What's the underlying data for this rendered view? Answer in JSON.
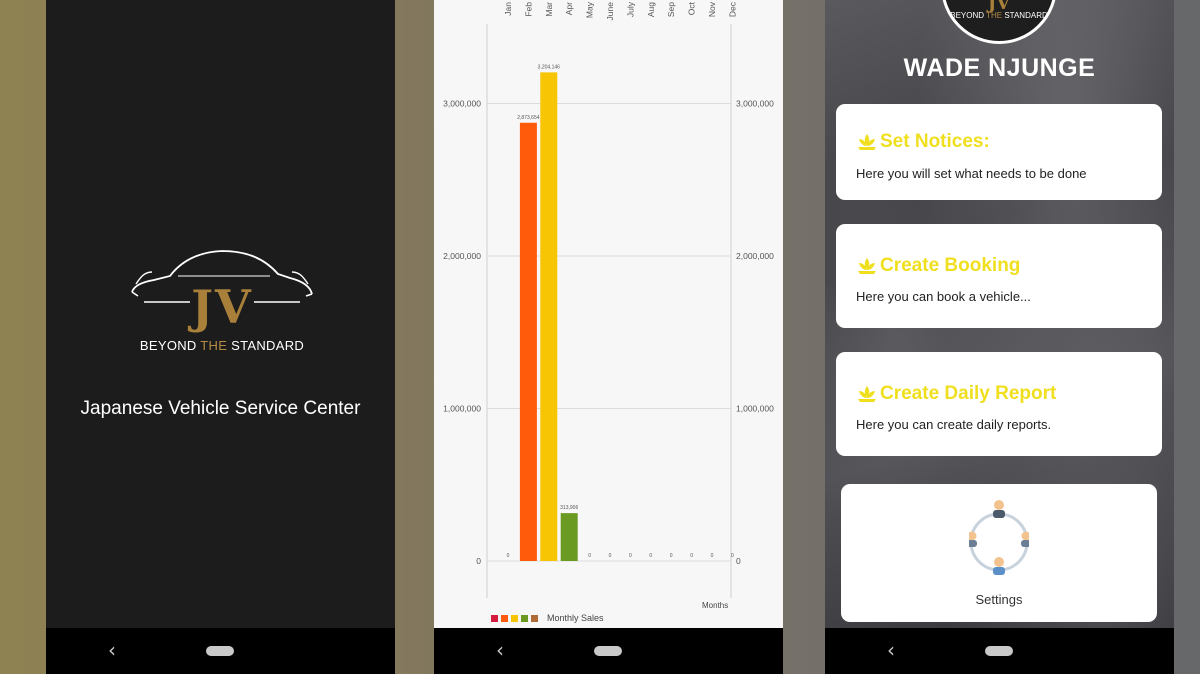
{
  "splash": {
    "logo_text": "JV",
    "logo_tagline_a": "BEYOND",
    "logo_tagline_b": "THE",
    "logo_tagline_c": "STANDARD",
    "title": "Japanese Vehicle Service Center"
  },
  "chart_data": {
    "type": "bar",
    "categories": [
      "Jan",
      "Feb",
      "Mar",
      "Apr",
      "May",
      "June",
      "July",
      "Aug",
      "Sep",
      "Oct",
      "Nov",
      "Dec"
    ],
    "values": [
      0,
      2873654,
      3204146,
      313906,
      0,
      0,
      0,
      0,
      0,
      0,
      0,
      0
    ],
    "value_labels": [
      "0",
      "2,873,654",
      "3,204,146",
      "313,906",
      "0",
      "0",
      "0",
      "0",
      "0",
      "0",
      "0",
      "0"
    ],
    "colors": [
      "#d51b3e",
      "#ff5b0a",
      "#f7c504",
      "#6a9a22",
      "#6a9a22",
      "#6a9a22",
      "#6a9a22",
      "#6a9a22",
      "#6a9a22",
      "#6a9a22",
      "#6a9a22",
      "#6a9a22"
    ],
    "yticks": [
      0,
      1000000,
      2000000,
      3000000
    ],
    "ytick_labels": [
      "0",
      "1,000,000",
      "2,000,000",
      "3,000,000"
    ],
    "ylim": [
      0,
      3600000
    ],
    "xlabel": "Months",
    "legend_label": "Monthly Sales",
    "legend_colors": [
      "#d51b3e",
      "#ff5b0a",
      "#f7c504",
      "#6a9a22",
      "#b06a35"
    ],
    "grid": true,
    "legend_position": "bottom-left"
  },
  "dashboard": {
    "avatar_logo_text": "JV",
    "avatar_tag_a": "BEYOND",
    "avatar_tag_b": "THE",
    "avatar_tag_c": "STANDARD",
    "user_name": "WADE NJUNGE",
    "accent_color": "#f0df1e",
    "cards": [
      {
        "title": "Set Notices:",
        "description": "Here you will set what needs to be done",
        "icon": "lotus-icon"
      },
      {
        "title": "Create Booking",
        "description": "Here you can book a vehicle...",
        "icon": "lotus-icon"
      },
      {
        "title": "Create Daily Report",
        "description": "Here you can create daily reports.",
        "icon": "lotus-icon"
      }
    ],
    "settings": {
      "label": "Settings",
      "icon": "team-network-icon"
    }
  },
  "navbar": {
    "back_icon": "back-chevron-icon",
    "home_icon": "home-pill-icon"
  }
}
